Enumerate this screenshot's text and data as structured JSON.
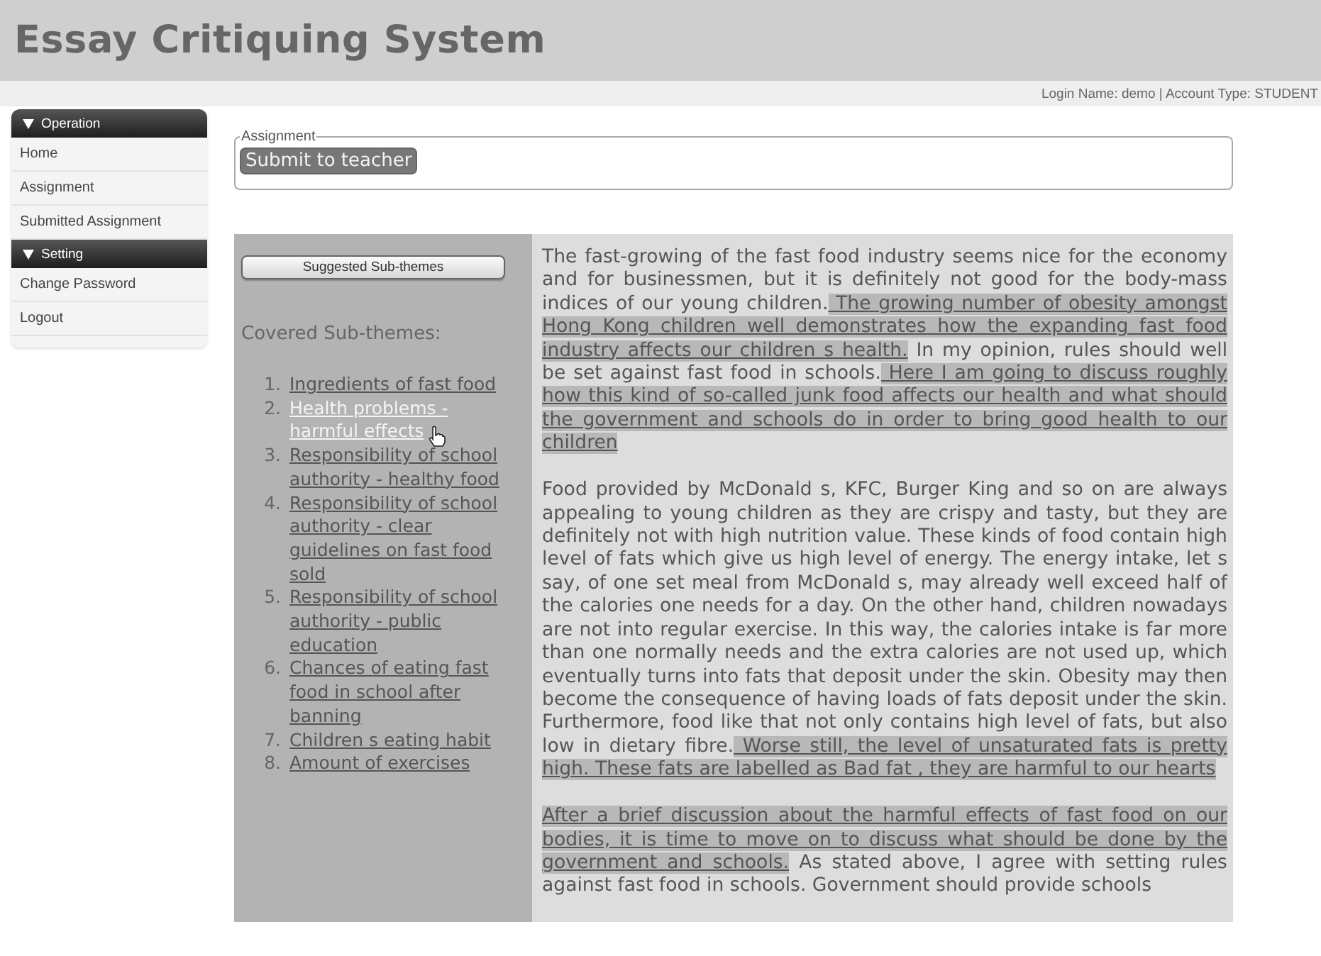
{
  "header": {
    "title": "Essay Critiquing System",
    "login_info": "Login Name: demo | Account Type: STUDENT"
  },
  "sidebar": {
    "sections": [
      {
        "title": "Operation",
        "expanded": true,
        "items": [
          "Home",
          "Assignment",
          "Submitted Assignment"
        ]
      },
      {
        "title": "Setting",
        "expanded": true,
        "items": [
          "Change Password",
          "Logout"
        ]
      }
    ]
  },
  "assignment": {
    "legend": "Assignment",
    "button": "Submit to teacher"
  },
  "subthemes": {
    "button": "Suggested Sub-themes",
    "heading": "Covered Sub-themes:",
    "items": [
      {
        "number": "1.",
        "label": "Ingredients of fast food",
        "selected": false
      },
      {
        "number": "2.",
        "label": "Health problems - harmful effects",
        "selected": true
      },
      {
        "number": "3.",
        "label": "Responsibility of school authority - healthy food",
        "selected": false
      },
      {
        "number": "4.",
        "label": "Responsibility of school authority - clear guidelines on fast food sold",
        "selected": false
      },
      {
        "number": "5.",
        "label": "Responsibility of school authority - public education",
        "selected": false
      },
      {
        "number": "6.",
        "label": "Chances of eating fast food in school after banning",
        "selected": false
      },
      {
        "number": "7.",
        "label": "Children s eating habit",
        "selected": false
      },
      {
        "number": "8.",
        "label": "Amount of exercises",
        "selected": false
      }
    ]
  },
  "essay": {
    "paragraphs": [
      [
        {
          "text": "The fast-growing of the fast food industry seems nice for the economy and for businessmen, but it is definitely not good for the body-mass indices of our young children.",
          "highlighted": false
        },
        {
          "text": " The growing number of obesity amongst Hong Kong children well demonstrates how the expanding fast food industry affects our children s health.",
          "highlighted": true
        },
        {
          "text": " In my opinion, rules should well be set against fast food in schools.",
          "highlighted": false
        },
        {
          "text": " Here I am going to discuss roughly how this kind of so-called junk food affects our health and what should the government and schools do in order to bring good health to our children",
          "highlighted": true
        }
      ],
      [
        {
          "text": "Food provided by McDonald s, KFC, Burger King and so on are always appealing to young children as they are crispy and tasty, but they are definitely not with high nutrition value. These kinds of food contain high level of fats which give us high level of energy. The energy intake, let s say, of one set meal from McDonald s, may already well exceed half of the calories one needs for a day. On the other hand, children nowadays are not into regular exercise. In this way, the calories intake is far more than one normally needs and the extra calories are not used up, which eventually turns into fats that deposit under the skin. Obesity may then become the consequence of having loads of fats deposit under the skin. Furthermore, food like that not only contains high level of fats, but also low in dietary fibre.",
          "highlighted": false
        },
        {
          "text": " Worse still, the level of unsaturated fats is pretty high. These fats are labelled as Bad fat , they are harmful to our hearts",
          "highlighted": true
        }
      ],
      [
        {
          "text": "After a brief discussion about the harmful effects of fast food on our bodies, it is time to move on to discuss what should be done by the government and schools.",
          "highlighted": true
        },
        {
          "text": " As stated above, I agree with setting rules against fast food in schools. Government should provide schools",
          "highlighted": false
        }
      ]
    ]
  }
}
